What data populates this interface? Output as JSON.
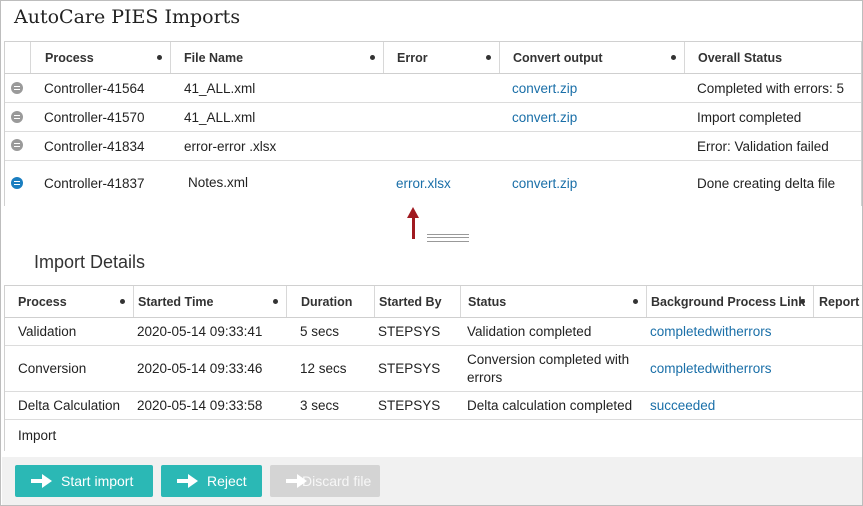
{
  "imports": {
    "title": "AutoCare PIES Imports",
    "columns": [
      "Process",
      "File Name",
      "Error",
      "Convert output",
      "Overall Status"
    ],
    "rows": [
      {
        "process": "Controller-41564",
        "file": "41_ALL.xml",
        "error": "",
        "convert": "convert.zip",
        "status": "Completed with errors: 5"
      },
      {
        "process": "Controller-41570",
        "file": "41_ALL.xml",
        "error": "",
        "convert": "convert.zip",
        "status": "Import completed"
      },
      {
        "process": "Controller-41834",
        "file": "error-error .xlsx",
        "error": "",
        "convert": "",
        "status": "Error: Validation failed"
      },
      {
        "process": "Controller-41837",
        "file": "Notes.xml",
        "error": "error.xlsx",
        "convert": "convert.zip",
        "status": "Done creating delta file"
      }
    ]
  },
  "details": {
    "title": "Import Details",
    "columns": [
      "Process",
      "Started Time",
      "Duration",
      "Started By",
      "Status",
      "Background Process Link",
      "Report"
    ],
    "rows": [
      {
        "process": "Validation",
        "started": "2020-05-14 09:33:41",
        "duration": "5 secs",
        "by": "STEPSYS",
        "status": "Validation completed",
        "link": "completedwitherrors"
      },
      {
        "process": "Conversion",
        "started": "2020-05-14 09:33:46",
        "duration": "12 secs",
        "by": "STEPSYS",
        "status": "Conversion completed with errors",
        "link": "completedwitherrors"
      },
      {
        "process": "Delta Calculation",
        "started": "2020-05-14 09:33:58",
        "duration": "3 secs",
        "by": "STEPSYS",
        "status": "Delta calculation completed",
        "link": "succeeded"
      },
      {
        "process": "Import",
        "started": "",
        "duration": "",
        "by": "",
        "status": "",
        "link": ""
      }
    ]
  },
  "buttons": {
    "start": "Start import",
    "reject": "Reject",
    "discard": "Discard file"
  },
  "colors": {
    "accent": "#2bb8b5",
    "link": "#1a6fa8",
    "arrow": "#a01a20"
  }
}
